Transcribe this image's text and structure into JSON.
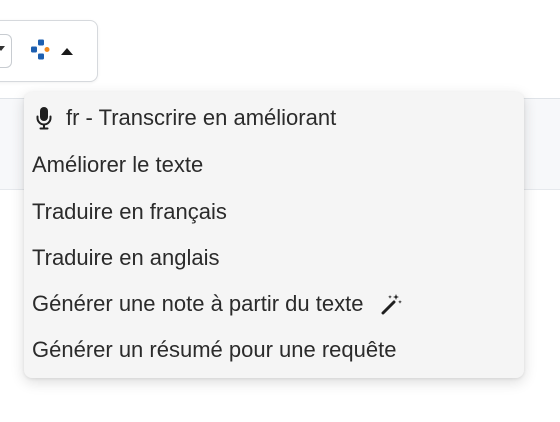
{
  "toolbar": {
    "ai_button_icon": "ai-logo-icon",
    "caret_icon": "caret-up-icon",
    "colors": {
      "logo_primary": "#1d5fb0",
      "logo_accent": "#f28a1e"
    }
  },
  "menu": {
    "items": [
      {
        "label": "fr - Transcrire en améliorant",
        "icon": "microphone-icon"
      },
      {
        "label": "Améliorer le texte"
      },
      {
        "label": "Traduire en français"
      },
      {
        "label": "Traduire en anglais"
      },
      {
        "label": "Générer une note à partir du texte",
        "icon": "magic-wand-icon"
      },
      {
        "label": "Générer un résumé pour une requête"
      }
    ]
  }
}
